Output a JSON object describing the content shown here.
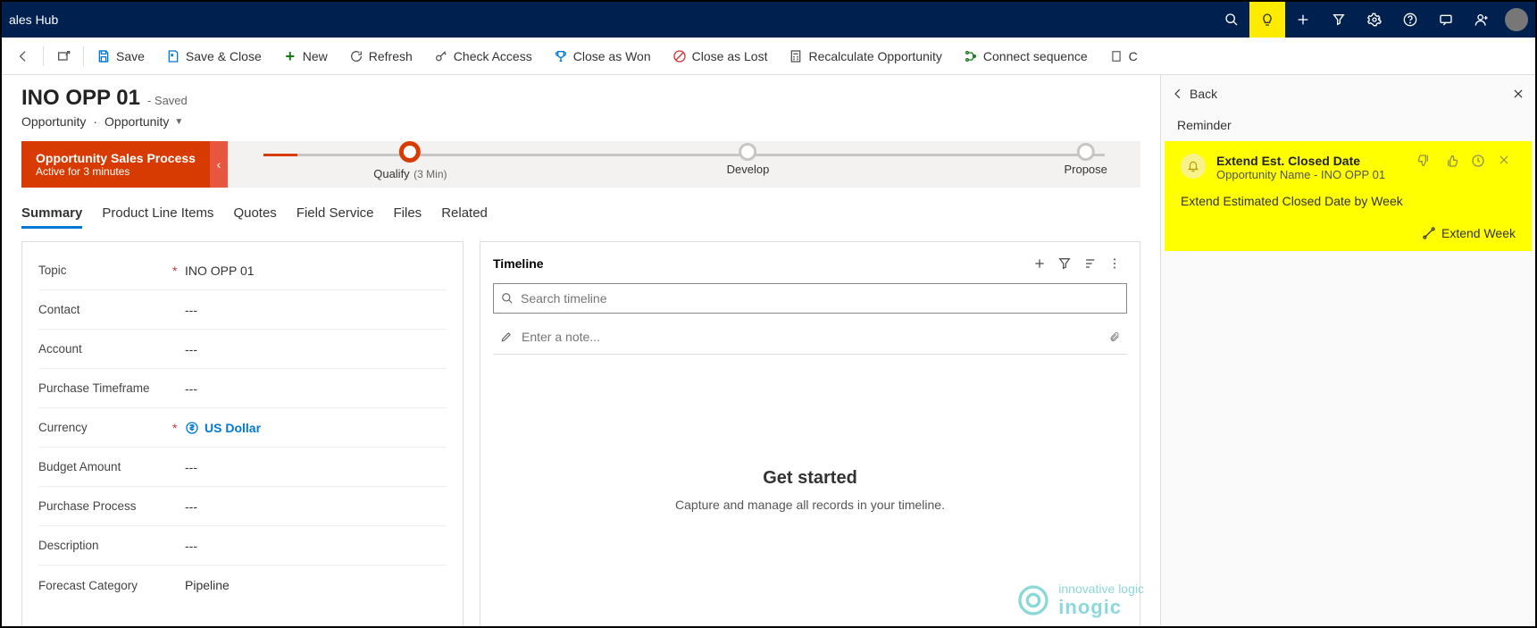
{
  "app": {
    "title": "ales Hub"
  },
  "commands": {
    "save": "Save",
    "save_close": "Save & Close",
    "new": "New",
    "refresh": "Refresh",
    "check_access": "Check Access",
    "close_won": "Close as Won",
    "close_lost": "Close as Lost",
    "recalc": "Recalculate Opportunity",
    "connect_seq": "Connect sequence",
    "truncated": "C"
  },
  "record": {
    "title": "INO OPP 01",
    "state": "- Saved",
    "entity": "Opportunity",
    "form": "Opportunity"
  },
  "bpf": {
    "name": "Opportunity Sales Process",
    "status": "Active for 3 minutes",
    "stages": [
      {
        "label": "Qualify",
        "duration": "(3 Min)",
        "active": true
      },
      {
        "label": "Develop",
        "duration": "",
        "active": false
      },
      {
        "label": "Propose",
        "duration": "",
        "active": false
      }
    ]
  },
  "tabs": [
    "Summary",
    "Product Line Items",
    "Quotes",
    "Field Service",
    "Files",
    "Related"
  ],
  "form_fields": [
    {
      "label": "Topic",
      "required": true,
      "value": "INO OPP 01"
    },
    {
      "label": "Contact",
      "required": false,
      "value": "---"
    },
    {
      "label": "Account",
      "required": false,
      "value": "---"
    },
    {
      "label": "Purchase Timeframe",
      "required": false,
      "value": "---"
    },
    {
      "label": "Currency",
      "required": true,
      "value": "US Dollar",
      "link": true
    },
    {
      "label": "Budget Amount",
      "required": false,
      "value": "---"
    },
    {
      "label": "Purchase Process",
      "required": false,
      "value": "---"
    },
    {
      "label": "Description",
      "required": false,
      "value": "---"
    },
    {
      "label": "Forecast Category",
      "required": false,
      "value": "Pipeline"
    }
  ],
  "timeline": {
    "title": "Timeline",
    "search_placeholder": "Search timeline",
    "note_placeholder": "Enter a note...",
    "empty_heading": "Get started",
    "empty_sub": "Capture and manage all records in your timeline."
  },
  "panel": {
    "back": "Back",
    "section": "Reminder",
    "card": {
      "title": "Extend Est. Closed Date",
      "subtitle": "Opportunity Name - INO OPP 01",
      "body": "Extend Estimated Closed Date by Week",
      "action": "Extend Week"
    }
  },
  "logo": {
    "tag": "innovative logic",
    "brand": "inogic"
  }
}
